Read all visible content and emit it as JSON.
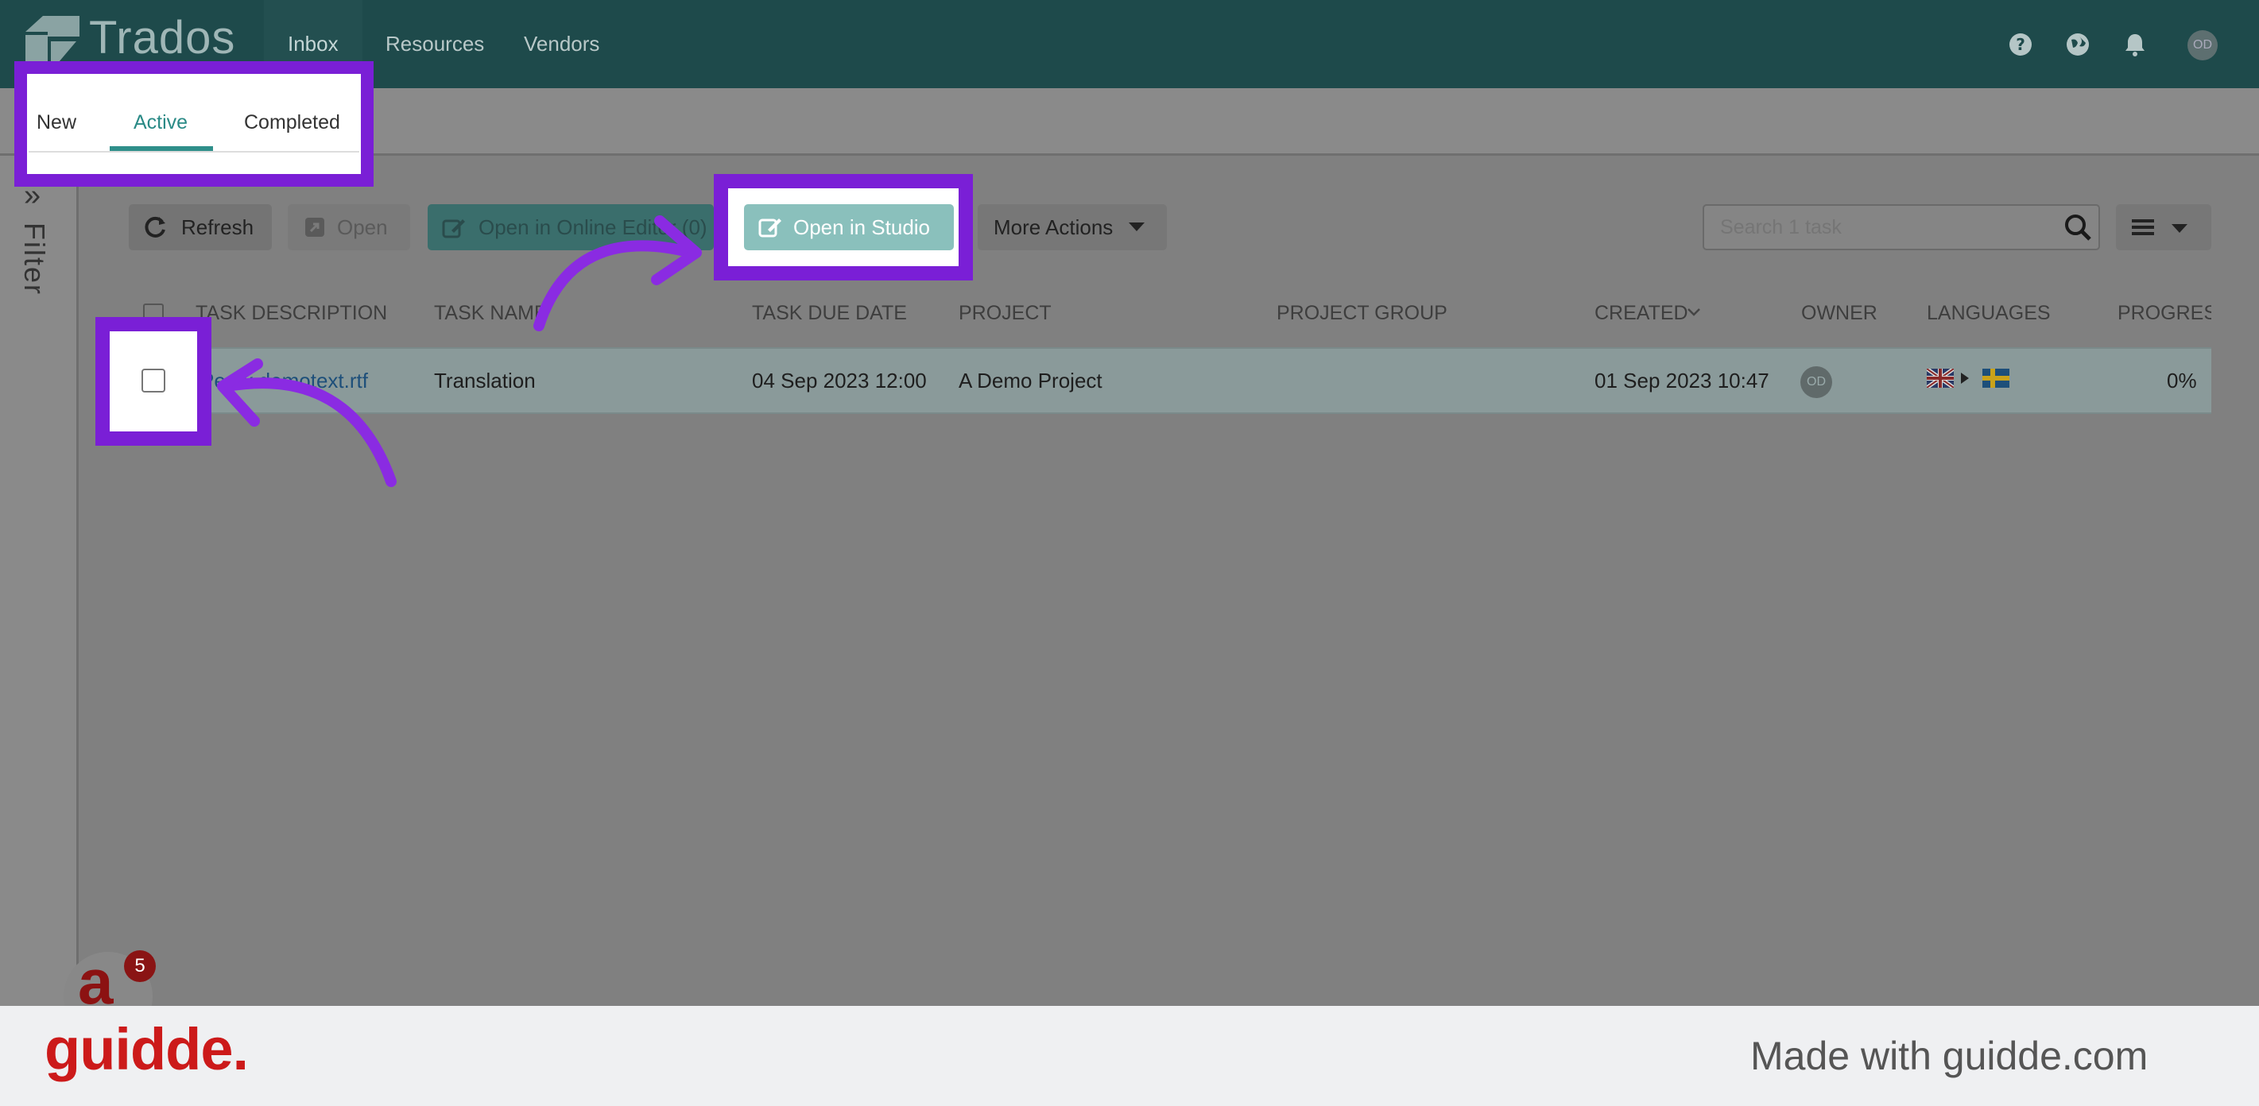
{
  "brand": "Trados",
  "nav": {
    "inbox": "Inbox",
    "resources": "Resources",
    "vendors": "Vendors"
  },
  "user_initials": "OD",
  "tabs": {
    "new": "New",
    "active": "Active",
    "completed": "Completed"
  },
  "sidebar": {
    "filter_label": "Filter"
  },
  "toolbar": {
    "refresh": "Refresh",
    "open": "Open",
    "open_online_editor": "Open in Online Editor (0)",
    "open_in_studio": "Open in Studio",
    "more_actions": "More Actions"
  },
  "search": {
    "placeholder": "Search 1 task"
  },
  "table": {
    "headers": {
      "task_description": "TASK DESCRIPTION",
      "task_name": "TASK NAME",
      "task_due_date": "TASK DUE DATE",
      "project": "PROJECT",
      "project_group": "PROJECT GROUP",
      "created": "CREATED",
      "owner": "OWNER",
      "languages": "LANGUAGES",
      "progress": "PROGRESS"
    },
    "row": {
      "file": "Persk demotext.rtf",
      "task_name": "Translation",
      "due_date": "04 Sep 2023 12:00",
      "project": "A Demo Project",
      "created": "01 Sep 2023 10:47",
      "owner_initials": "OD",
      "progress": "0%"
    }
  },
  "notification_badge": {
    "letter": "a",
    "count": "5"
  },
  "footer": {
    "logo": "guidde.",
    "text": "Made with guidde.com"
  },
  "colors": {
    "highlight": "#7a1fd6",
    "topbar": "#1e4a4b",
    "accent": "#2f8f8a",
    "footer_logo": "#cc1a1a"
  }
}
